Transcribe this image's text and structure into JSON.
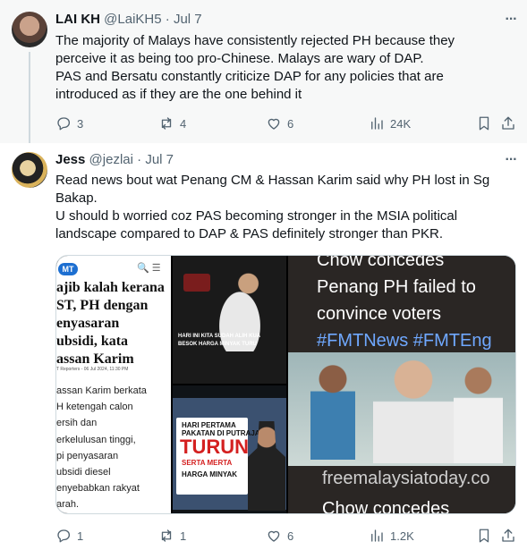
{
  "tweets": [
    {
      "name": "LAI KH",
      "handle": "@LaiKH5",
      "dot": "·",
      "date": "Jul 7",
      "more": "···",
      "lines": [
        "The majority of Malays have consistently rejected PH because they",
        "perceive it as being too pro-Chinese. Malays are wary of DAP.",
        "PAS and Bersatu constantly criticize DAP for any policies that are",
        "introduced as if they are the one behind it"
      ],
      "replies": "3",
      "reposts": "4",
      "likes": "6",
      "views": "24K"
    },
    {
      "name": "Jess",
      "handle": "@jezlai",
      "dot": "·",
      "date": "Jul 7",
      "more": "···",
      "lines": [
        "Read news bout wat Penang CM & Hassan Karim said why PH lost in Sg",
        "Bakap.",
        "U should b worried coz PAS becoming stronger in the MSIA political",
        "landscape compared to DAP & PAS definitely stronger than PKR."
      ],
      "replies": "1",
      "reposts": "1",
      "likes": "6",
      "views": "1.2K"
    }
  ],
  "media": {
    "article": {
      "logo": "MT",
      "icons": "🔍 ☰",
      "headline": [
        "ajib kalah kerana",
        "ST, PH dengan",
        "enyasaran",
        "ubsidi, kata",
        "assan Karim"
      ],
      "meta": "T Reporters - 06 Jul 2024, 11:30 PM",
      "body": [
        "assan Karim berkata",
        "H ketengah calon",
        "ersih dan",
        "erkelulusan tinggi,",
        "pi penyasaran",
        "ubsidi diesel",
        "enyebabkan rakyat",
        "arah."
      ]
    },
    "video1": {
      "caption": [
        "HARI INI KITA SUDAH ALIH KUA",
        "BESOK HARGA MINYAK TURU"
      ]
    },
    "video2": {
      "line1": [
        "HARI PERTAMA",
        "PAKATAN DI PUTRAJAYA"
      ],
      "turun": "TURUN",
      "line2": "SERTA MERTA",
      "line3": "HARGA MINYAK"
    },
    "fmt": {
      "top": "Chow concedes",
      "line1": "Penang PH failed to",
      "line2": "convince voters",
      "tags": "#FMTNews #FMTEng",
      "url": "freemalaysiatoday.co",
      "bottom": "Chow concedes"
    }
  },
  "colors": {
    "text": "#0f1419",
    "secondary": "#536471",
    "thread_line": "#cfd9de",
    "hashtag": "#6fa8ff",
    "turun_red": "#d42020"
  },
  "icons": [
    "more-icon",
    "reply-icon",
    "repost-icon",
    "like-icon",
    "views-icon",
    "bookmark-icon",
    "share-icon"
  ]
}
